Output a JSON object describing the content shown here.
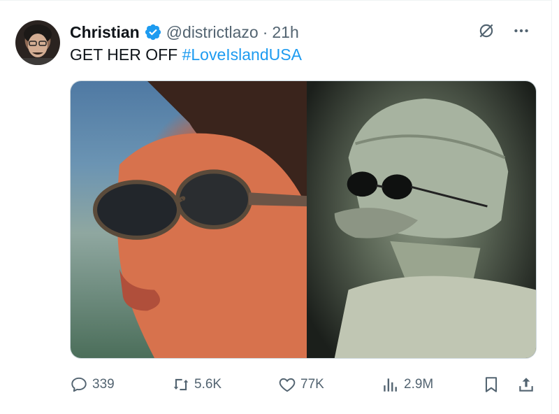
{
  "author": {
    "name": "Christian",
    "handle": "@districtlazo",
    "separator": "·",
    "time": "21h"
  },
  "tweet": {
    "text": "GET HER OFF",
    "hashtag": "#LoveIslandUSA"
  },
  "media": {
    "left_image": "woman-with-sunglasses-photo",
    "right_image": "stop-motion-puppet-with-sunglasses"
  },
  "metrics": {
    "replies": "339",
    "retweets": "5.6K",
    "likes": "77K",
    "views": "2.9M"
  },
  "icons": {
    "verified": "verified-badge-icon",
    "grok": "grok-icon",
    "more": "more-icon",
    "reply": "reply-icon",
    "retweet": "retweet-icon",
    "like": "heart-icon",
    "views": "views-icon",
    "bookmark": "bookmark-icon",
    "share": "share-icon"
  },
  "colors": {
    "accent": "#1d9bf0",
    "secondary_text": "#536471",
    "primary_text": "#0f1419"
  }
}
